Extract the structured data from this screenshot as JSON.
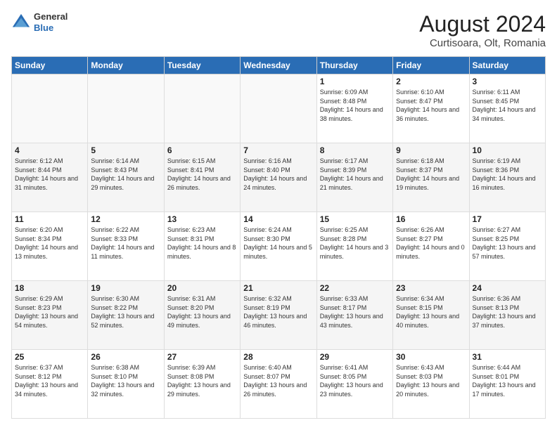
{
  "header": {
    "logo": {
      "general": "General",
      "blue": "Blue"
    },
    "title": "August 2024",
    "location": "Curtisoara, Olt, Romania"
  },
  "calendar": {
    "weekdays": [
      "Sunday",
      "Monday",
      "Tuesday",
      "Wednesday",
      "Thursday",
      "Friday",
      "Saturday"
    ],
    "weeks": [
      [
        {
          "day": "",
          "detail": ""
        },
        {
          "day": "",
          "detail": ""
        },
        {
          "day": "",
          "detail": ""
        },
        {
          "day": "",
          "detail": ""
        },
        {
          "day": "1",
          "detail": "Sunrise: 6:09 AM\nSunset: 8:48 PM\nDaylight: 14 hours and 38 minutes."
        },
        {
          "day": "2",
          "detail": "Sunrise: 6:10 AM\nSunset: 8:47 PM\nDaylight: 14 hours and 36 minutes."
        },
        {
          "day": "3",
          "detail": "Sunrise: 6:11 AM\nSunset: 8:45 PM\nDaylight: 14 hours and 34 minutes."
        }
      ],
      [
        {
          "day": "4",
          "detail": "Sunrise: 6:12 AM\nSunset: 8:44 PM\nDaylight: 14 hours and 31 minutes."
        },
        {
          "day": "5",
          "detail": "Sunrise: 6:14 AM\nSunset: 8:43 PM\nDaylight: 14 hours and 29 minutes."
        },
        {
          "day": "6",
          "detail": "Sunrise: 6:15 AM\nSunset: 8:41 PM\nDaylight: 14 hours and 26 minutes."
        },
        {
          "day": "7",
          "detail": "Sunrise: 6:16 AM\nSunset: 8:40 PM\nDaylight: 14 hours and 24 minutes."
        },
        {
          "day": "8",
          "detail": "Sunrise: 6:17 AM\nSunset: 8:39 PM\nDaylight: 14 hours and 21 minutes."
        },
        {
          "day": "9",
          "detail": "Sunrise: 6:18 AM\nSunset: 8:37 PM\nDaylight: 14 hours and 19 minutes."
        },
        {
          "day": "10",
          "detail": "Sunrise: 6:19 AM\nSunset: 8:36 PM\nDaylight: 14 hours and 16 minutes."
        }
      ],
      [
        {
          "day": "11",
          "detail": "Sunrise: 6:20 AM\nSunset: 8:34 PM\nDaylight: 14 hours and 13 minutes."
        },
        {
          "day": "12",
          "detail": "Sunrise: 6:22 AM\nSunset: 8:33 PM\nDaylight: 14 hours and 11 minutes."
        },
        {
          "day": "13",
          "detail": "Sunrise: 6:23 AM\nSunset: 8:31 PM\nDaylight: 14 hours and 8 minutes."
        },
        {
          "day": "14",
          "detail": "Sunrise: 6:24 AM\nSunset: 8:30 PM\nDaylight: 14 hours and 5 minutes."
        },
        {
          "day": "15",
          "detail": "Sunrise: 6:25 AM\nSunset: 8:28 PM\nDaylight: 14 hours and 3 minutes."
        },
        {
          "day": "16",
          "detail": "Sunrise: 6:26 AM\nSunset: 8:27 PM\nDaylight: 14 hours and 0 minutes."
        },
        {
          "day": "17",
          "detail": "Sunrise: 6:27 AM\nSunset: 8:25 PM\nDaylight: 13 hours and 57 minutes."
        }
      ],
      [
        {
          "day": "18",
          "detail": "Sunrise: 6:29 AM\nSunset: 8:23 PM\nDaylight: 13 hours and 54 minutes."
        },
        {
          "day": "19",
          "detail": "Sunrise: 6:30 AM\nSunset: 8:22 PM\nDaylight: 13 hours and 52 minutes."
        },
        {
          "day": "20",
          "detail": "Sunrise: 6:31 AM\nSunset: 8:20 PM\nDaylight: 13 hours and 49 minutes."
        },
        {
          "day": "21",
          "detail": "Sunrise: 6:32 AM\nSunset: 8:19 PM\nDaylight: 13 hours and 46 minutes."
        },
        {
          "day": "22",
          "detail": "Sunrise: 6:33 AM\nSunset: 8:17 PM\nDaylight: 13 hours and 43 minutes."
        },
        {
          "day": "23",
          "detail": "Sunrise: 6:34 AM\nSunset: 8:15 PM\nDaylight: 13 hours and 40 minutes."
        },
        {
          "day": "24",
          "detail": "Sunrise: 6:36 AM\nSunset: 8:13 PM\nDaylight: 13 hours and 37 minutes."
        }
      ],
      [
        {
          "day": "25",
          "detail": "Sunrise: 6:37 AM\nSunset: 8:12 PM\nDaylight: 13 hours and 34 minutes."
        },
        {
          "day": "26",
          "detail": "Sunrise: 6:38 AM\nSunset: 8:10 PM\nDaylight: 13 hours and 32 minutes."
        },
        {
          "day": "27",
          "detail": "Sunrise: 6:39 AM\nSunset: 8:08 PM\nDaylight: 13 hours and 29 minutes."
        },
        {
          "day": "28",
          "detail": "Sunrise: 6:40 AM\nSunset: 8:07 PM\nDaylight: 13 hours and 26 minutes."
        },
        {
          "day": "29",
          "detail": "Sunrise: 6:41 AM\nSunset: 8:05 PM\nDaylight: 13 hours and 23 minutes."
        },
        {
          "day": "30",
          "detail": "Sunrise: 6:43 AM\nSunset: 8:03 PM\nDaylight: 13 hours and 20 minutes."
        },
        {
          "day": "31",
          "detail": "Sunrise: 6:44 AM\nSunset: 8:01 PM\nDaylight: 13 hours and 17 minutes."
        }
      ]
    ]
  }
}
